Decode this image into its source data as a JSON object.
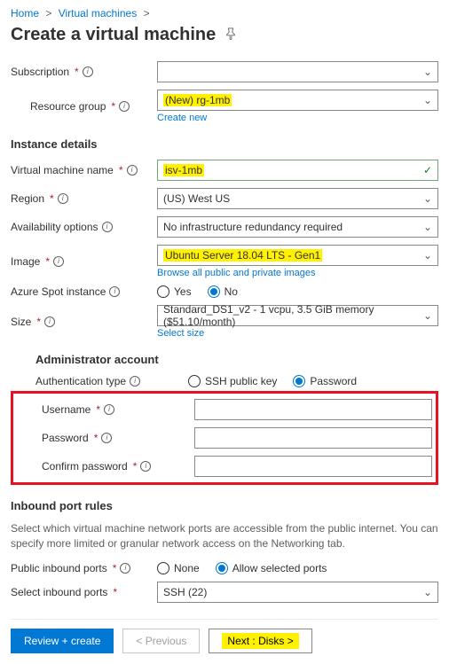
{
  "breadcrumb": {
    "home": "Home",
    "vms": "Virtual machines"
  },
  "page_title": "Create a virtual machine",
  "labels": {
    "subscription": "Subscription",
    "resource_group": "Resource group",
    "create_new": "Create new",
    "instance_details": "Instance details",
    "vm_name": "Virtual machine name",
    "region": "Region",
    "availability": "Availability options",
    "image": "Image",
    "browse_images": "Browse all public and private images",
    "spot": "Azure Spot instance",
    "size": "Size",
    "select_size": "Select size",
    "admin_account": "Administrator account",
    "auth_type": "Authentication type",
    "username": "Username",
    "password": "Password",
    "confirm_password": "Confirm password",
    "inbound_rules": "Inbound port rules",
    "public_inbound": "Public inbound ports",
    "select_inbound": "Select inbound ports"
  },
  "values": {
    "subscription": "",
    "resource_group": "(New) rg-1mb",
    "vm_name": "isv-1mb",
    "region": "(US) West US",
    "availability": "No infrastructure redundancy required",
    "image": "Ubuntu Server 18.04 LTS - Gen1",
    "size": "Standard_DS1_v2 - 1 vcpu, 3.5 GiB memory ($51.10/month)",
    "select_inbound": "SSH (22)"
  },
  "radios": {
    "yes": "Yes",
    "no": "No",
    "ssh": "SSH public key",
    "password": "Password",
    "none": "None",
    "allow": "Allow selected ports"
  },
  "helper": {
    "inbound": "Select which virtual machine network ports are accessible from the public internet. You can specify more limited or granular network access on the Networking tab."
  },
  "footer": {
    "review": "Review + create",
    "previous": "< Previous",
    "next": "Next : Disks >"
  }
}
